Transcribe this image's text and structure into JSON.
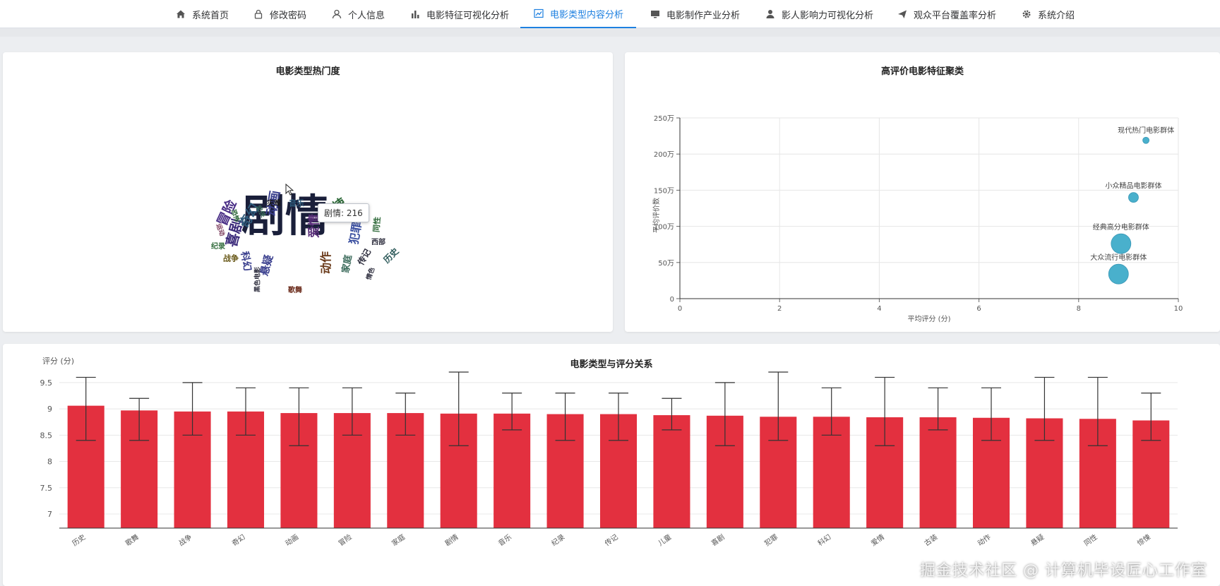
{
  "nav": {
    "items": [
      {
        "label": "系统首页",
        "icon": "home-icon"
      },
      {
        "label": "修改密码",
        "icon": "lock-icon"
      },
      {
        "label": "个人信息",
        "icon": "user-outline-icon"
      },
      {
        "label": "电影特征可视化分析",
        "icon": "bar-chart-icon"
      },
      {
        "label": "电影类型内容分析",
        "icon": "line-chart-icon",
        "active": true
      },
      {
        "label": "电影制作产业分析",
        "icon": "monitor-icon"
      },
      {
        "label": "影人影响力可视化分析",
        "icon": "user-solid-icon"
      },
      {
        "label": "观众平台覆盖率分析",
        "icon": "send-icon"
      },
      {
        "label": "系统介绍",
        "icon": "gear-icon"
      }
    ]
  },
  "wordcloud_panel": {
    "title": "电影类型热门度",
    "words": [
      {
        "text": "剧情",
        "color": "#1a1f3a"
      },
      {
        "text": "喜剧",
        "color": "#3b2a7a"
      },
      {
        "text": "动画",
        "color": "#3a3f8e"
      },
      {
        "text": "冒险",
        "color": "#4a2f86"
      },
      {
        "text": "奇幻",
        "color": "#2d5a7a"
      },
      {
        "text": "惊悚",
        "color": "#2f6a3a"
      },
      {
        "text": "爱情",
        "color": "#5a2f7a"
      },
      {
        "text": "犯罪",
        "color": "#3a4fa0"
      },
      {
        "text": "悬疑",
        "color": "#3a3f8e"
      },
      {
        "text": "科幻",
        "color": "#3a3f8e"
      },
      {
        "text": "动作",
        "color": "#6a3a1a"
      },
      {
        "text": "家庭",
        "color": "#3a6a5a"
      },
      {
        "text": "传记",
        "color": "#2f2f3f"
      },
      {
        "text": "音乐",
        "color": "#2d5a7a"
      },
      {
        "text": "灾难",
        "color": "#1a1a1a"
      },
      {
        "text": "武侠",
        "color": "#3a6a5a"
      },
      {
        "text": "恐怖",
        "color": "#2f6a3a"
      },
      {
        "text": "运动",
        "color": "#7a3a5a"
      },
      {
        "text": "纪录",
        "color": "#2f6a3a"
      },
      {
        "text": "战争",
        "color": "#6a5a1a"
      },
      {
        "text": "古装",
        "color": "#2f6a3a"
      },
      {
        "text": "同性",
        "color": "#2f6a3a"
      },
      {
        "text": "西部",
        "color": "#2f2f3f"
      },
      {
        "text": "历史",
        "color": "#2d5a5a"
      },
      {
        "text": "情色",
        "color": "#2f2f3f"
      },
      {
        "text": "歌舞",
        "color": "#6a2a1a"
      },
      {
        "text": "黑色电影",
        "color": "#2f2f3f"
      }
    ],
    "tooltip": "剧情: 216"
  },
  "cluster_panel": {
    "chart_data": {
      "type": "scatter",
      "title": "高评价电影特征聚类",
      "xlabel": "平均评分 (分)",
      "ylabel": "平均评价数",
      "xlim": [
        0,
        10
      ],
      "ylim": [
        0,
        2500000
      ],
      "x_ticks": [
        "0",
        "2",
        "4",
        "6",
        "8",
        "10"
      ],
      "y_ticks": [
        "0",
        "50万",
        "100万",
        "150万",
        "200万",
        "250万"
      ],
      "grid": true,
      "series": [
        {
          "name": "现代热门电影群体",
          "x": 9.35,
          "y": 2190000,
          "size": 1
        },
        {
          "name": "小众精品电影群体",
          "x": 9.1,
          "y": 1400000,
          "size": 2
        },
        {
          "name": "经典高分电影群体",
          "x": 8.85,
          "y": 760000,
          "size": 4
        },
        {
          "name": "大众流行电影群体",
          "x": 8.8,
          "y": 340000,
          "size": 4
        }
      ],
      "color": "#3aaac8"
    }
  },
  "bar_panel": {
    "chart_data": {
      "type": "bar",
      "title": "电影类型与评分关系",
      "ylabel": "评分 (分)",
      "ylim": [
        7,
        9.7
      ],
      "y_ticks": [
        "7",
        "7.5",
        "8",
        "8.5",
        "9",
        "9.5"
      ],
      "grid": true,
      "categories": [
        "历史",
        "歌舞",
        "战争",
        "奇幻",
        "动画",
        "冒险",
        "家庭",
        "剧情",
        "音乐",
        "纪录",
        "传记",
        "儿童",
        "喜剧",
        "犯罪",
        "科幻",
        "爱情",
        "古装",
        "动作",
        "悬疑",
        "同性",
        "惊悚"
      ],
      "values": [
        9.06,
        8.97,
        8.95,
        8.95,
        8.92,
        8.92,
        8.92,
        8.91,
        8.91,
        8.9,
        8.9,
        8.88,
        8.87,
        8.85,
        8.85,
        8.84,
        8.84,
        8.83,
        8.82,
        8.81,
        8.78
      ],
      "error_low": [
        8.4,
        8.4,
        8.5,
        8.5,
        8.3,
        8.5,
        8.5,
        8.3,
        8.6,
        8.4,
        8.4,
        8.6,
        8.3,
        8.4,
        8.5,
        8.3,
        8.6,
        8.4,
        8.4,
        8.3,
        8.4
      ],
      "error_high": [
        9.6,
        9.2,
        9.5,
        9.4,
        9.4,
        9.4,
        9.3,
        9.7,
        9.3,
        9.3,
        9.3,
        9.2,
        9.5,
        9.7,
        9.4,
        9.6,
        9.4,
        9.4,
        9.6,
        9.6,
        9.3
      ],
      "bar_color": "#e3303f"
    }
  },
  "watermark": "掘金技术社区 @ 计算机毕设匠心工作室"
}
